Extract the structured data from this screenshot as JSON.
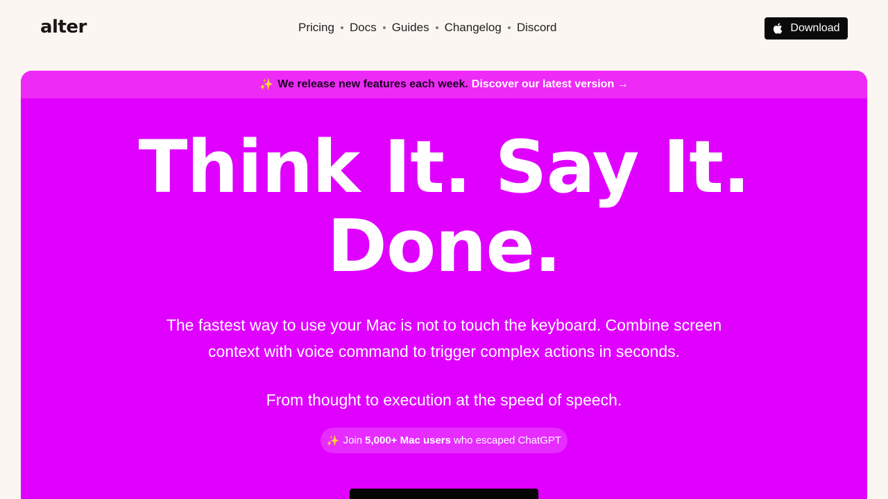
{
  "header": {
    "logo": "alter",
    "nav": [
      {
        "label": "Pricing"
      },
      {
        "label": "Docs"
      },
      {
        "label": "Guides"
      },
      {
        "label": "Changelog"
      },
      {
        "label": "Discord"
      }
    ],
    "download_label": "Download"
  },
  "banner": {
    "icon": "sparkles-icon",
    "text": "We release new features each week.",
    "link": "Discover our latest version →"
  },
  "hero": {
    "headline_line1": "Think It. Say It.",
    "headline_line2": "Done.",
    "description": "The fastest way to use your Mac is not to touch the keyboard. Combine screen context with voice command to trigger complex actions in seconds.",
    "tagline": "From thought to execution at the speed of speech.",
    "pill_prefix": "Join",
    "pill_bold": "5,000+ Mac users",
    "pill_suffix": "who escaped ChatGPT"
  },
  "colors": {
    "hero_bg": "#e000ff",
    "banner_bg": "#ee2af7",
    "page_bg": "#fbf6f1",
    "button_bg": "#0a0a0a"
  }
}
